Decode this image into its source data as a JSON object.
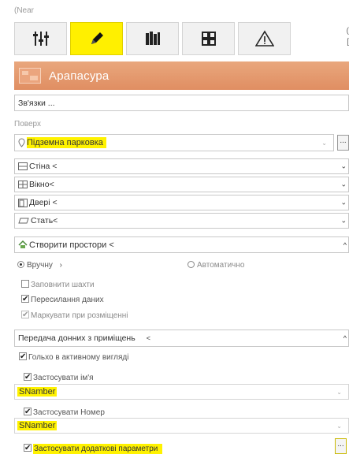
{
  "top": {
    "near_label": "(Near",
    "edge_glyph_top": "(",
    "edge_glyph_bottom": "["
  },
  "toolbar": {
    "buttons": [
      {
        "icon": "sliders-icon",
        "active": false
      },
      {
        "icon": "pencil-icon",
        "active": true
      },
      {
        "icon": "library-icon",
        "active": false
      },
      {
        "icon": "grid-icon",
        "active": false
      },
      {
        "icon": "warning-icon",
        "active": false
      }
    ],
    "active_color": "#fff000"
  },
  "header": {
    "title": "Арапасура",
    "color": "#e08e62"
  },
  "links_field": {
    "label": "Зв'язки ..."
  },
  "floor": {
    "label": "Поверх",
    "value": "Підземна парковка",
    "dots": "..."
  },
  "sections": [
    {
      "label": "Стіна <",
      "icon": "wall-icon",
      "chevron": "⌄"
    },
    {
      "label": "Вікно<",
      "icon": "window-icon",
      "chevron": "⌄"
    },
    {
      "label": "Двері <",
      "icon": "door-icon",
      "chevron": "⌄"
    },
    {
      "label": "Стать<",
      "icon": "floor-icon",
      "chevron": "⌄"
    }
  ],
  "create_spaces": {
    "label": "Створити простори <",
    "chevron": "^",
    "mode_manual": "Вручну",
    "mode_manual_arrow": "›",
    "mode_auto": "Автоматично",
    "fill_shafts": "Заповнити шахти",
    "transfer_data": "Пересилання даних",
    "mark_on_place": "Маркувати при розміщенні"
  },
  "transfer": {
    "label": "Передача донних з приміщень",
    "arrow": "<",
    "chevron": "^",
    "active_view_only": "Гольхо в активному вигляді",
    "apply_name": "Застосувати ім'я",
    "name_value": "SNamber",
    "apply_number": "Застосувати Номер",
    "number_value": "SNamber",
    "apply_extra": "Застосувати додаткові параметри",
    "extra_btn": "..."
  },
  "colors": {
    "highlight": "#fff200",
    "border": "#c8c8c8"
  }
}
